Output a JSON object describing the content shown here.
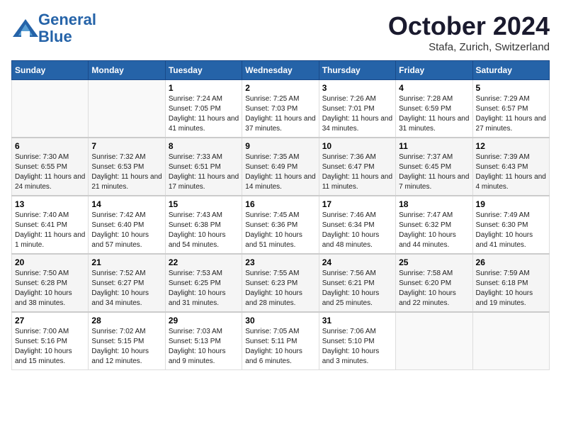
{
  "header": {
    "logo_line1": "General",
    "logo_line2": "Blue",
    "month": "October 2024",
    "location": "Stafa, Zurich, Switzerland"
  },
  "weekdays": [
    "Sunday",
    "Monday",
    "Tuesday",
    "Wednesday",
    "Thursday",
    "Friday",
    "Saturday"
  ],
  "weeks": [
    [
      {
        "day": "",
        "info": ""
      },
      {
        "day": "",
        "info": ""
      },
      {
        "day": "1",
        "info": "Sunrise: 7:24 AM\nSunset: 7:05 PM\nDaylight: 11 hours and 41 minutes."
      },
      {
        "day": "2",
        "info": "Sunrise: 7:25 AM\nSunset: 7:03 PM\nDaylight: 11 hours and 37 minutes."
      },
      {
        "day": "3",
        "info": "Sunrise: 7:26 AM\nSunset: 7:01 PM\nDaylight: 11 hours and 34 minutes."
      },
      {
        "day": "4",
        "info": "Sunrise: 7:28 AM\nSunset: 6:59 PM\nDaylight: 11 hours and 31 minutes."
      },
      {
        "day": "5",
        "info": "Sunrise: 7:29 AM\nSunset: 6:57 PM\nDaylight: 11 hours and 27 minutes."
      }
    ],
    [
      {
        "day": "6",
        "info": "Sunrise: 7:30 AM\nSunset: 6:55 PM\nDaylight: 11 hours and 24 minutes."
      },
      {
        "day": "7",
        "info": "Sunrise: 7:32 AM\nSunset: 6:53 PM\nDaylight: 11 hours and 21 minutes."
      },
      {
        "day": "8",
        "info": "Sunrise: 7:33 AM\nSunset: 6:51 PM\nDaylight: 11 hours and 17 minutes."
      },
      {
        "day": "9",
        "info": "Sunrise: 7:35 AM\nSunset: 6:49 PM\nDaylight: 11 hours and 14 minutes."
      },
      {
        "day": "10",
        "info": "Sunrise: 7:36 AM\nSunset: 6:47 PM\nDaylight: 11 hours and 11 minutes."
      },
      {
        "day": "11",
        "info": "Sunrise: 7:37 AM\nSunset: 6:45 PM\nDaylight: 11 hours and 7 minutes."
      },
      {
        "day": "12",
        "info": "Sunrise: 7:39 AM\nSunset: 6:43 PM\nDaylight: 11 hours and 4 minutes."
      }
    ],
    [
      {
        "day": "13",
        "info": "Sunrise: 7:40 AM\nSunset: 6:41 PM\nDaylight: 11 hours and 1 minute."
      },
      {
        "day": "14",
        "info": "Sunrise: 7:42 AM\nSunset: 6:40 PM\nDaylight: 10 hours and 57 minutes."
      },
      {
        "day": "15",
        "info": "Sunrise: 7:43 AM\nSunset: 6:38 PM\nDaylight: 10 hours and 54 minutes."
      },
      {
        "day": "16",
        "info": "Sunrise: 7:45 AM\nSunset: 6:36 PM\nDaylight: 10 hours and 51 minutes."
      },
      {
        "day": "17",
        "info": "Sunrise: 7:46 AM\nSunset: 6:34 PM\nDaylight: 10 hours and 48 minutes."
      },
      {
        "day": "18",
        "info": "Sunrise: 7:47 AM\nSunset: 6:32 PM\nDaylight: 10 hours and 44 minutes."
      },
      {
        "day": "19",
        "info": "Sunrise: 7:49 AM\nSunset: 6:30 PM\nDaylight: 10 hours and 41 minutes."
      }
    ],
    [
      {
        "day": "20",
        "info": "Sunrise: 7:50 AM\nSunset: 6:28 PM\nDaylight: 10 hours and 38 minutes."
      },
      {
        "day": "21",
        "info": "Sunrise: 7:52 AM\nSunset: 6:27 PM\nDaylight: 10 hours and 34 minutes."
      },
      {
        "day": "22",
        "info": "Sunrise: 7:53 AM\nSunset: 6:25 PM\nDaylight: 10 hours and 31 minutes."
      },
      {
        "day": "23",
        "info": "Sunrise: 7:55 AM\nSunset: 6:23 PM\nDaylight: 10 hours and 28 minutes."
      },
      {
        "day": "24",
        "info": "Sunrise: 7:56 AM\nSunset: 6:21 PM\nDaylight: 10 hours and 25 minutes."
      },
      {
        "day": "25",
        "info": "Sunrise: 7:58 AM\nSunset: 6:20 PM\nDaylight: 10 hours and 22 minutes."
      },
      {
        "day": "26",
        "info": "Sunrise: 7:59 AM\nSunset: 6:18 PM\nDaylight: 10 hours and 19 minutes."
      }
    ],
    [
      {
        "day": "27",
        "info": "Sunrise: 7:00 AM\nSunset: 5:16 PM\nDaylight: 10 hours and 15 minutes."
      },
      {
        "day": "28",
        "info": "Sunrise: 7:02 AM\nSunset: 5:15 PM\nDaylight: 10 hours and 12 minutes."
      },
      {
        "day": "29",
        "info": "Sunrise: 7:03 AM\nSunset: 5:13 PM\nDaylight: 10 hours and 9 minutes."
      },
      {
        "day": "30",
        "info": "Sunrise: 7:05 AM\nSunset: 5:11 PM\nDaylight: 10 hours and 6 minutes."
      },
      {
        "day": "31",
        "info": "Sunrise: 7:06 AM\nSunset: 5:10 PM\nDaylight: 10 hours and 3 minutes."
      },
      {
        "day": "",
        "info": ""
      },
      {
        "day": "",
        "info": ""
      }
    ]
  ]
}
